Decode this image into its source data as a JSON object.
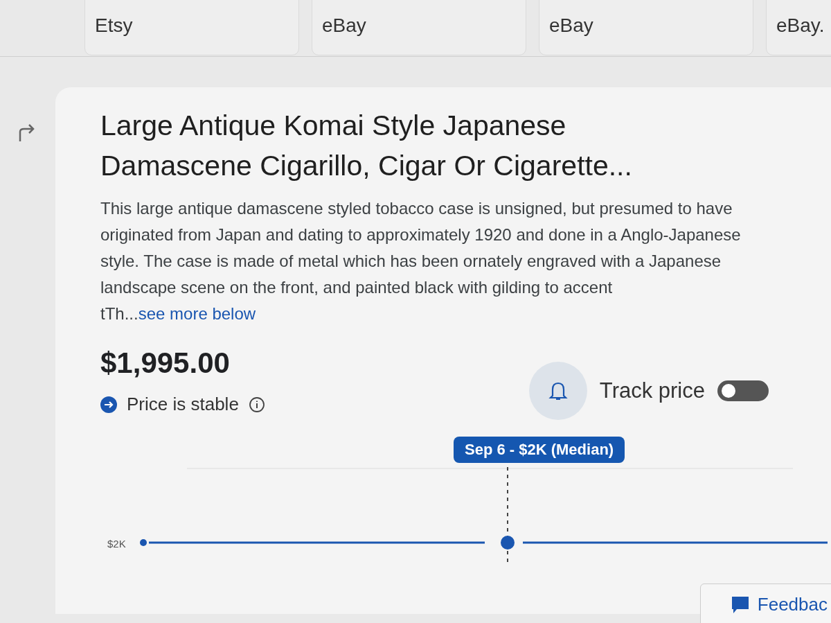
{
  "related_items": [
    {
      "source": "Etsy"
    },
    {
      "source": "eBay"
    },
    {
      "source": "eBay"
    },
    {
      "source": "eBay."
    }
  ],
  "product": {
    "title": "Large Antique Komai Style Japanese Damascene Cigarillo, Cigar Or Cigarette...",
    "description": "This large antique damascene styled tobacco case is unsigned, but presumed to have originated from Japan and dating to approximately 1920 and done in a Anglo-Japanese style. The case is made of metal which has been ornately engraved with a Japanese landscape scene on the front, and painted black with gilding to accent tTh...",
    "see_more": "see more below",
    "price": "$1,995.00",
    "price_status": "Price is stable"
  },
  "track_price": {
    "label": "Track price",
    "on": false
  },
  "price_chart": {
    "tooltip": "Sep 6 - $2K (Median)",
    "y_label": "$2K"
  },
  "feedback_button": "Feedbac"
}
